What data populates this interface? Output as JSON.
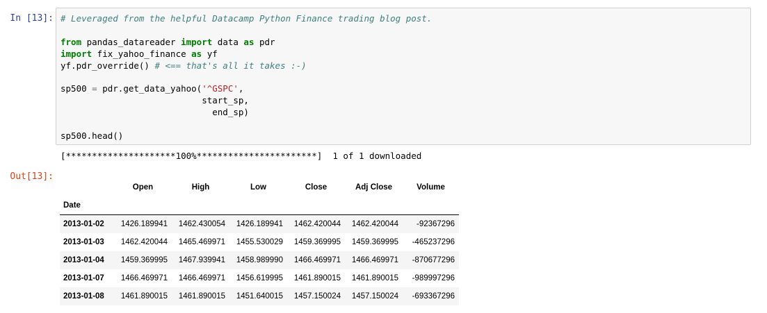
{
  "cell_in": {
    "prompt": "In [13]:",
    "code_lines": [
      [
        {
          "t": "# Leveraged from the helpful Datacamp Python Finance trading blog post.",
          "c": "comment"
        }
      ],
      [],
      [
        {
          "t": "from",
          "c": "kw"
        },
        {
          "t": " pandas_datareader ",
          "c": ""
        },
        {
          "t": "import",
          "c": "kw"
        },
        {
          "t": " data ",
          "c": ""
        },
        {
          "t": "as",
          "c": "kw"
        },
        {
          "t": " pdr",
          "c": ""
        }
      ],
      [
        {
          "t": "import",
          "c": "kw"
        },
        {
          "t": " fix_yahoo_finance ",
          "c": ""
        },
        {
          "t": "as",
          "c": "kw"
        },
        {
          "t": " yf",
          "c": ""
        }
      ],
      [
        {
          "t": "yf.pdr_override() ",
          "c": ""
        },
        {
          "t": "# <== that's all it takes :-)",
          "c": "comment"
        }
      ],
      [],
      [
        {
          "t": "sp500 ",
          "c": ""
        },
        {
          "t": "=",
          "c": "op"
        },
        {
          "t": " pdr.get_data_yahoo(",
          "c": ""
        },
        {
          "t": "'^GSPC'",
          "c": "str"
        },
        {
          "t": ",",
          "c": ""
        }
      ],
      [
        {
          "t": "                           start_sp,",
          "c": ""
        }
      ],
      [
        {
          "t": "                             end_sp)",
          "c": ""
        }
      ],
      [],
      [
        {
          "t": "sp500.head()",
          "c": ""
        }
      ]
    ]
  },
  "stream_output": "[*********************100%***********************]  1 of 1 downloaded",
  "cell_out": {
    "prompt": "Out[13]:",
    "table": {
      "columns": [
        "Open",
        "High",
        "Low",
        "Close",
        "Adj Close",
        "Volume"
      ],
      "index_name": "Date",
      "rows": [
        {
          "date": "2013-01-02",
          "values": [
            "1426.189941",
            "1462.430054",
            "1426.189941",
            "1462.420044",
            "1462.420044",
            "-92367296"
          ]
        },
        {
          "date": "2013-01-03",
          "values": [
            "1462.420044",
            "1465.469971",
            "1455.530029",
            "1459.369995",
            "1459.369995",
            "-465237296"
          ]
        },
        {
          "date": "2013-01-04",
          "values": [
            "1459.369995",
            "1467.939941",
            "1458.989990",
            "1466.469971",
            "1466.469971",
            "-870677296"
          ]
        },
        {
          "date": "2013-01-07",
          "values": [
            "1466.469971",
            "1466.469971",
            "1456.619995",
            "1461.890015",
            "1461.890015",
            "-989997296"
          ]
        },
        {
          "date": "2013-01-08",
          "values": [
            "1461.890015",
            "1461.890015",
            "1451.640015",
            "1457.150024",
            "1457.150024",
            "-693367296"
          ]
        }
      ]
    }
  }
}
